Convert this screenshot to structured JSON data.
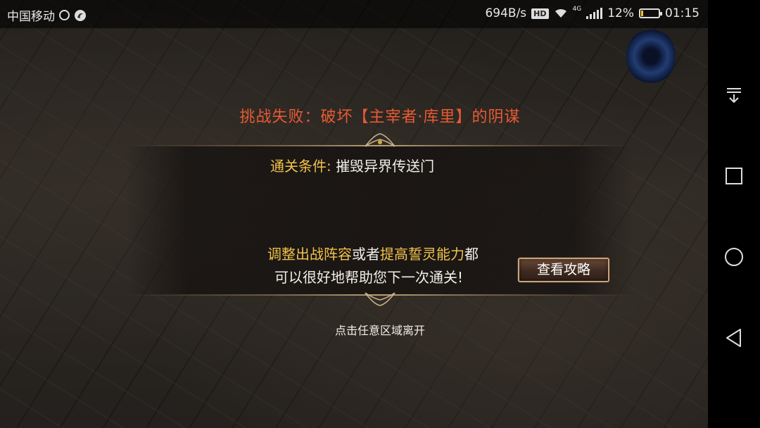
{
  "status_bar": {
    "carrier": "中国移动",
    "net_speed": "694B/s",
    "hd_badge": "HD",
    "network_type": "4G",
    "battery_percent": "12%",
    "battery_level": 0.12,
    "battery_color": "#f2c230",
    "time": "01:15",
    "icons": [
      "alarm-icon",
      "app-notification-icon",
      "hd-icon",
      "wifi-icon",
      "signal-icon",
      "battery-icon"
    ]
  },
  "dialog": {
    "title": "挑战失败：破坏【主宰者·库里】的阴谋",
    "title_color": "#e85a34",
    "condition_label": "通关条件:",
    "condition_value": "摧毁异界传送门",
    "hint": {
      "line1_seg1": "调整出战阵容",
      "line1_seg2": "或者",
      "line1_seg3": "提高誓灵能力",
      "line1_seg4": "都",
      "line2": "可以很好地帮助您下一次通关!"
    },
    "highlight_color": "#f2c24a",
    "guide_button": "查看攻略",
    "leave_hint": "点击任意区域离开"
  },
  "nav_bar": {
    "buttons": [
      "notification-pull-icon",
      "recent-apps-icon",
      "home-icon",
      "back-icon"
    ]
  }
}
